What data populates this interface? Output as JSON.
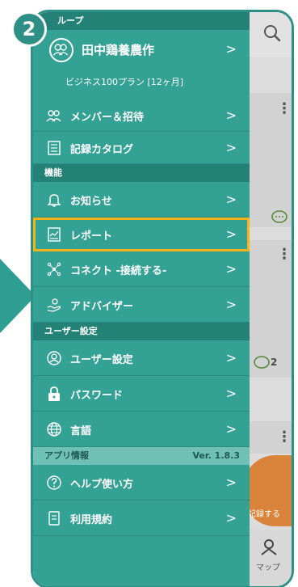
{
  "step_badge": "2",
  "header_group": "ループ",
  "account": {
    "name": "田中鶏養農作",
    "plan": "ビジネス100プラン [12ヶ月]",
    "chevron": ">"
  },
  "menu_group": [
    {
      "label": "メンバー＆招待",
      "icon": "members-icon"
    },
    {
      "label": "記録カタログ",
      "icon": "catalog-icon"
    }
  ],
  "section_kiki": "機能",
  "menu_kiki": [
    {
      "label": "お知らせ",
      "icon": "bell-icon"
    },
    {
      "label": "レポート",
      "icon": "report-icon"
    },
    {
      "label": "コネクト -接続する-",
      "icon": "connect-icon"
    },
    {
      "label": "アドバイザー",
      "icon": "advisor-icon"
    }
  ],
  "section_user": "ユーザー設定",
  "menu_user": [
    {
      "label": "ユーザー設定",
      "icon": "user-settings-icon"
    },
    {
      "label": "パスワード",
      "icon": "lock-icon"
    },
    {
      "label": "言語",
      "icon": "globe-icon"
    }
  ],
  "section_app": "アプリ情報",
  "app_version": "Ver. 1.8.3",
  "menu_app": [
    {
      "label": "ヘルプ使い方",
      "icon": "help-icon"
    },
    {
      "label": "利用規約",
      "icon": "terms-icon"
    }
  ],
  "chevron": ">",
  "bg": {
    "comment_count": "2",
    "fab_label": "記録する",
    "map_label": "マップ"
  },
  "colors": {
    "drawer": "#34a195",
    "header": "#238175",
    "highlight": "#f2b41a",
    "fab": "#d9843a"
  }
}
